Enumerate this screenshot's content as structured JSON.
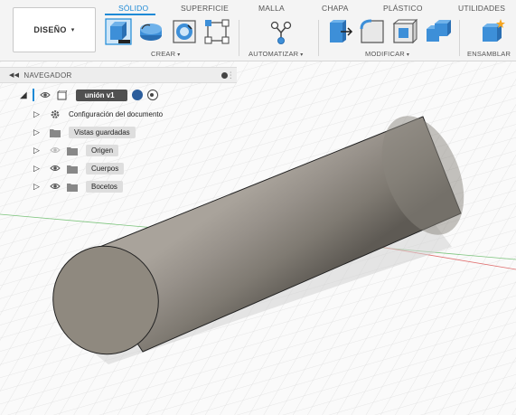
{
  "toolbar": {
    "workspace_button": {
      "label": "DISEÑO",
      "caret": "▾"
    },
    "tabs": [
      {
        "label": "SÓLIDO",
        "active": true
      },
      {
        "label": "SUPERFICIE",
        "active": false
      },
      {
        "label": "MALLA",
        "active": false
      },
      {
        "label": "CHAPA",
        "active": false
      },
      {
        "label": "PLÁSTICO",
        "active": false
      },
      {
        "label": "UTILIDADES",
        "active": false
      }
    ],
    "groups": [
      {
        "label": "CREAR",
        "caret": "▾",
        "tools": [
          "new-component-icon",
          "extrude-icon",
          "revolve-icon",
          "sketch-icon"
        ]
      },
      {
        "label": "AUTOMATIZAR",
        "caret": "▾",
        "tools": [
          "automate-icon"
        ]
      },
      {
        "label": "MODIFICAR",
        "caret": "▾",
        "tools": [
          "press-pull-icon",
          "fillet-icon",
          "shell-icon",
          "combine-icon"
        ]
      },
      {
        "label": "ENSAMBLAR",
        "tools": [
          "new-joint-icon"
        ]
      }
    ],
    "accent_color": "#1e8ad6"
  },
  "navigator": {
    "title": "NAVEGADOR",
    "root": {
      "label": "unión v1",
      "badges": [
        "link-badge-icon",
        "radio-badge-icon"
      ]
    },
    "items": [
      {
        "label": "Configuración del documento",
        "icon": "gear-icon",
        "has_eye": false
      },
      {
        "label": "Vistas guardadas",
        "icon": "folder-icon",
        "has_eye": false
      },
      {
        "label": "Origen",
        "icon": "folder-icon",
        "has_eye": true,
        "eye_dimmed": true
      },
      {
        "label": "Cuerpos",
        "icon": "folder-icon",
        "has_eye": true,
        "eye_dimmed": false
      },
      {
        "label": "Bocetos",
        "icon": "folder-icon",
        "has_eye": true,
        "eye_dimmed": false
      }
    ]
  },
  "viewport": {
    "body_shape": "cylinder",
    "body_color": "#8f897f",
    "grid": true,
    "axis_colors": {
      "x": "#e07070",
      "y": "#7cc47c"
    }
  }
}
